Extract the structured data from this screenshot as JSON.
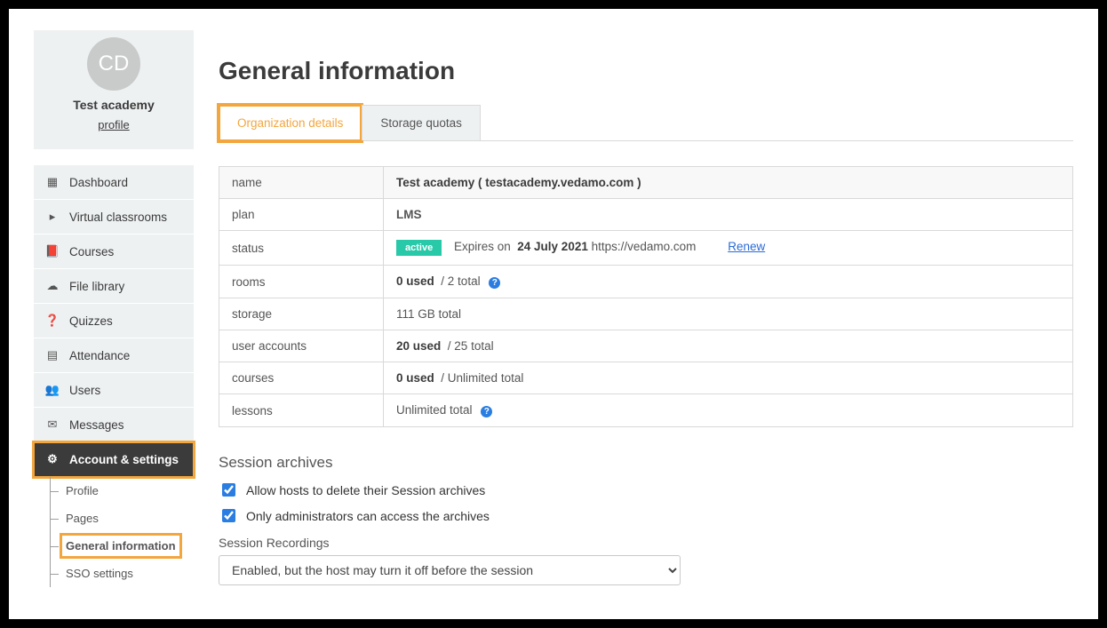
{
  "profile": {
    "avatar_initials": "CD",
    "org_name": "Test academy",
    "profile_link": "profile"
  },
  "sidebar": {
    "items": [
      {
        "label": "Dashboard",
        "icon": "dashboard"
      },
      {
        "label": "Virtual classrooms",
        "icon": "play"
      },
      {
        "label": "Courses",
        "icon": "book"
      },
      {
        "label": "File library",
        "icon": "cloud"
      },
      {
        "label": "Quizzes",
        "icon": "help"
      },
      {
        "label": "Attendance",
        "icon": "list"
      },
      {
        "label": "Users",
        "icon": "users"
      },
      {
        "label": "Messages",
        "icon": "mail"
      },
      {
        "label": "Account & settings",
        "icon": "gear",
        "active": true
      }
    ],
    "subitems": [
      {
        "label": "Profile"
      },
      {
        "label": "Pages"
      },
      {
        "label": "General information",
        "current": true
      },
      {
        "label": "SSO settings"
      }
    ]
  },
  "page": {
    "title": "General information"
  },
  "tabs": {
    "t0": "Organization details",
    "t1": "Storage quotas"
  },
  "details": {
    "name": {
      "label": "name",
      "value": "Test academy ( testacademy.vedamo.com )"
    },
    "plan": {
      "label": "plan",
      "value": "LMS"
    },
    "status": {
      "label": "status",
      "badge": "active",
      "expires_label": "Expires on",
      "expires_date": "24 July 2021",
      "url": "https://vedamo.com",
      "renew": "Renew"
    },
    "rooms": {
      "label": "rooms",
      "used": "0 used",
      "total": "/ 2 total"
    },
    "storage": {
      "label": "storage",
      "value": "111 GB total"
    },
    "accounts": {
      "label": "user accounts",
      "used": "20 used",
      "total": "/ 25 total"
    },
    "courses": {
      "label": "courses",
      "used": "0 used",
      "total": "/ Unlimited total"
    },
    "lessons": {
      "label": "lessons",
      "value": "Unlimited total"
    }
  },
  "session": {
    "heading": "Session archives",
    "check1": "Allow hosts to delete their Session archives",
    "check2": "Only administrators can access the archives",
    "recordings_label": "Session Recordings",
    "recordings_value": "Enabled, but the host may turn it off before the session"
  }
}
